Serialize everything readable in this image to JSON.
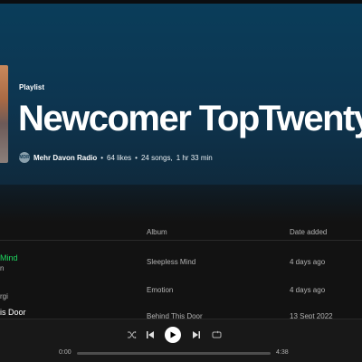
{
  "playlist": {
    "kind": "Playlist",
    "title": "Newcomer TopTwenty",
    "owner_initials": "MDR",
    "owner": "Mehr Davon Radio",
    "likes": "64 likes",
    "songs": "24 songs,",
    "duration": "1 hr 33 min"
  },
  "columns": {
    "album": "Album",
    "date_added": "Date added"
  },
  "tracks": [
    {
      "title": "Mind",
      "artist": "n",
      "album": "Sleepless Mind",
      "date_added": "4 days ago",
      "playing": true
    },
    {
      "title": "",
      "artist": "rgi",
      "album": "Emotion",
      "date_added": "4 days ago",
      "playing": false
    },
    {
      "title": "is Door",
      "artist": "",
      "album": "Behind This Door",
      "date_added": "13 Sept 2022",
      "playing": false
    }
  ],
  "player": {
    "elapsed": "0:00",
    "total": "4:38",
    "progress": 0,
    "icons": [
      "shuffle-icon",
      "previous-icon",
      "play-icon",
      "next-icon",
      "repeat-icon"
    ]
  },
  "colors": {
    "accent": "#1ed760",
    "hero": "#0a3d5a",
    "background": "#121212"
  }
}
